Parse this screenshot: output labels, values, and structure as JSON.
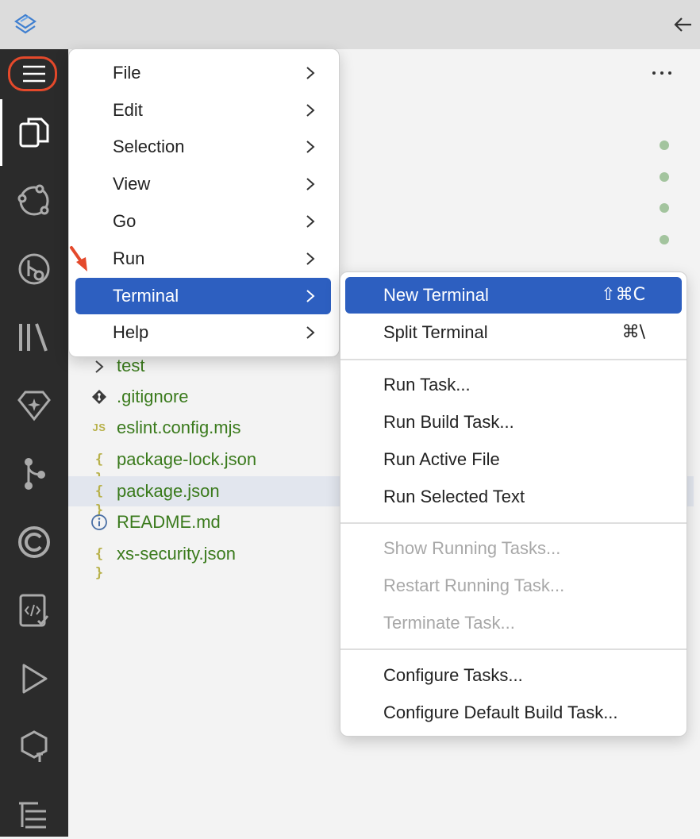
{
  "menu": {
    "items": [
      {
        "label": "File"
      },
      {
        "label": "Edit"
      },
      {
        "label": "Selection"
      },
      {
        "label": "View"
      },
      {
        "label": "Go"
      },
      {
        "label": "Run"
      },
      {
        "label": "Terminal"
      },
      {
        "label": "Help"
      }
    ]
  },
  "submenu": {
    "new_terminal": {
      "label": "New Terminal",
      "shortcut": "⇧⌘C"
    },
    "split_terminal": {
      "label": "Split Terminal",
      "shortcut": "⌘\\"
    },
    "run_task": "Run Task...",
    "run_build_task": "Run Build Task...",
    "run_active_file": "Run Active File",
    "run_selected_text": "Run Selected Text",
    "show_running_tasks": "Show Running Tasks...",
    "restart_running_task": "Restart Running Task...",
    "terminate_task": "Terminate Task...",
    "configure_tasks": "Configure Tasks...",
    "configure_default_build_task": "Configure Default Build Task..."
  },
  "files": [
    {
      "label": "test",
      "icon": "chevron-right-icon"
    },
    {
      "label": ".gitignore",
      "icon": "git-icon"
    },
    {
      "label": "eslint.config.mjs",
      "icon": "js-file-icon",
      "badge": "JS"
    },
    {
      "label": "package-lock.json",
      "icon": "json-file-icon",
      "badge": "{ }"
    },
    {
      "label": "package.json",
      "icon": "json-file-icon",
      "badge": "{ }"
    },
    {
      "label": "README.md",
      "icon": "info-icon"
    },
    {
      "label": "xs-security.json",
      "icon": "json-file-icon",
      "badge": "{ }"
    }
  ],
  "colors": {
    "accent": "#2d5fc0",
    "file_text": "#3a7a1c",
    "annotation": "#e4492b",
    "activity_bar": "#2b2b2b"
  }
}
